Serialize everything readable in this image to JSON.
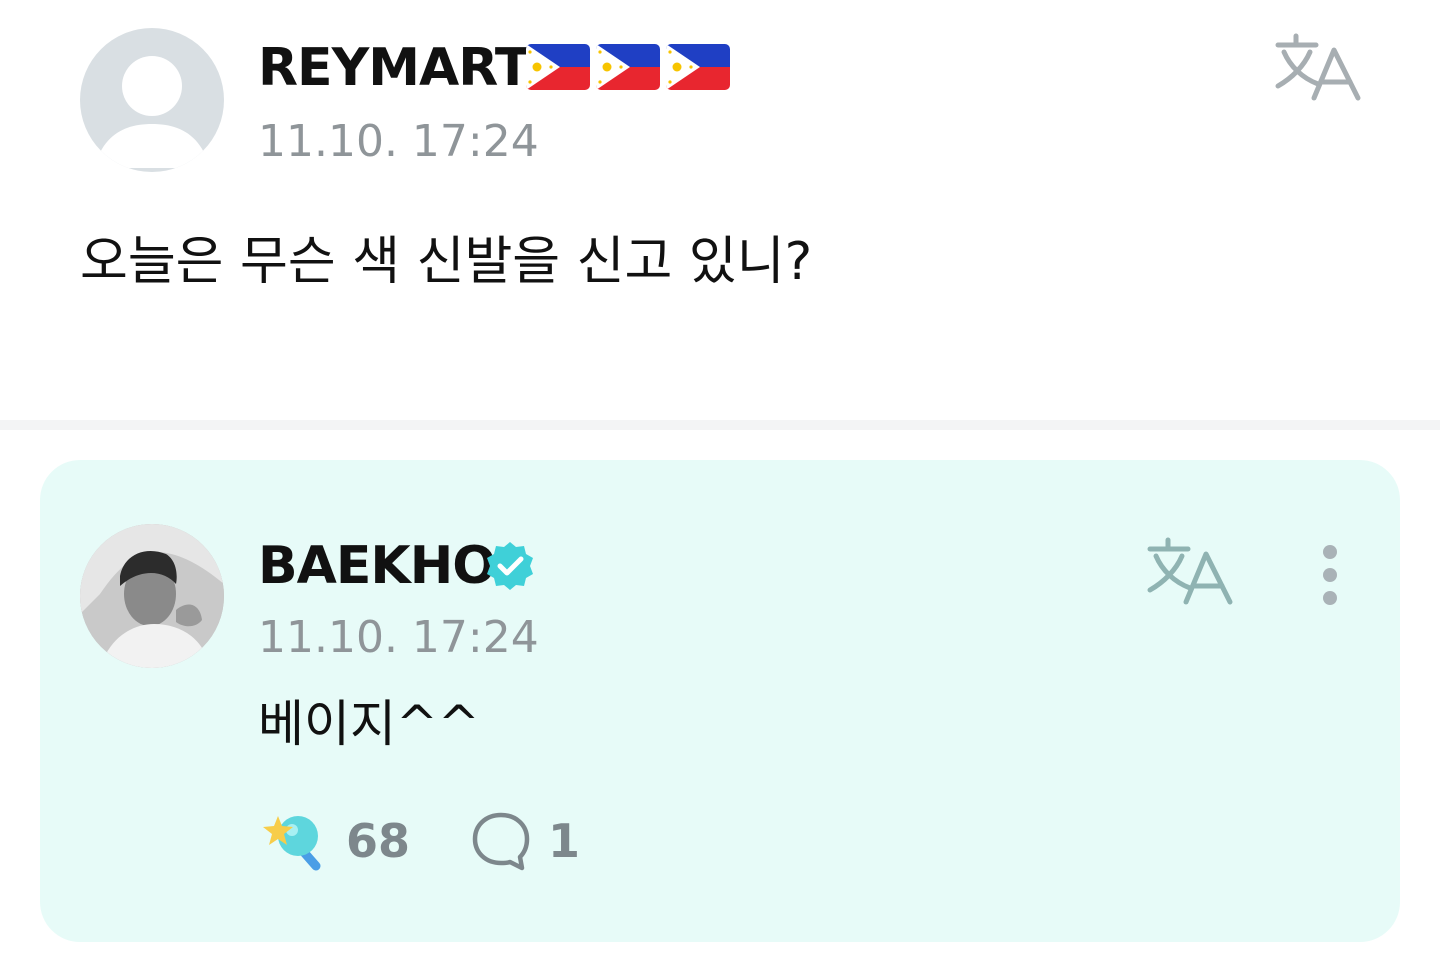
{
  "post": {
    "author": "REYMART",
    "author_flags": [
      "philippines-flag",
      "philippines-flag",
      "philippines-flag"
    ],
    "timestamp": "11.10. 17:24",
    "body": "오늘은 무슨 색 신발을 신고 있니?",
    "translate_icon": "translate-icon"
  },
  "reply": {
    "author": "BAEKHO",
    "verified_icon": "verified-badge-icon",
    "timestamp": "11.10. 17:24",
    "body": "베이지^^",
    "translate_icon": "translate-icon",
    "more_icon": "more-vertical-icon",
    "reaction_icon": "star-light-stick-icon",
    "reaction_count": "68",
    "comment_icon": "comment-bubble-icon",
    "comment_count": "1"
  },
  "colors": {
    "reply_background": "#e7fbf8",
    "verified": "#3fd0d8",
    "muted_text": "#8f9599",
    "translate_gray": "#a7aeb2",
    "translate_teal": "#8fb3b2"
  }
}
